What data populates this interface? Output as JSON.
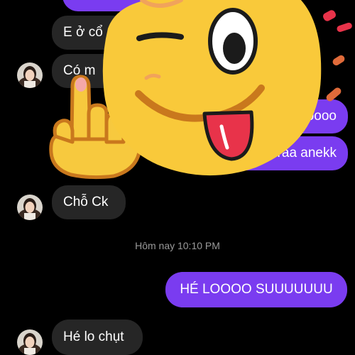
{
  "thread": {
    "messages": [
      {
        "side": "recv",
        "text": "E ở cổ",
        "avatar": false
      },
      {
        "side": "recv",
        "text": "Có m",
        "avatar": true
      },
      {
        "side": "sent",
        "text": "oooo",
        "avatar": false
      },
      {
        "side": "sent",
        "text": "raa anekk",
        "avatar": false
      },
      {
        "side": "recv",
        "text": "Chỗ Ck",
        "avatar": true
      },
      {
        "side": "sent",
        "text": "HÉ LOOOO SUUUUUUU",
        "avatar": false
      },
      {
        "side": "recv",
        "text": "Hé lo chụt",
        "avatar": true
      }
    ],
    "timestamp": "Hôm nay 10:10 PM"
  },
  "sticker": {
    "name": "winking-emoji-tongue-out-middle-finger-sticker"
  },
  "colors": {
    "background": "#000000",
    "received_bubble": "#262626",
    "sent_bubble": "#7a3cf0",
    "timestamp_text": "#9a9a9a",
    "emoji_yellow": "#f9c93a",
    "emoji_outline": "#c9781d",
    "tongue": "#e8334a"
  }
}
